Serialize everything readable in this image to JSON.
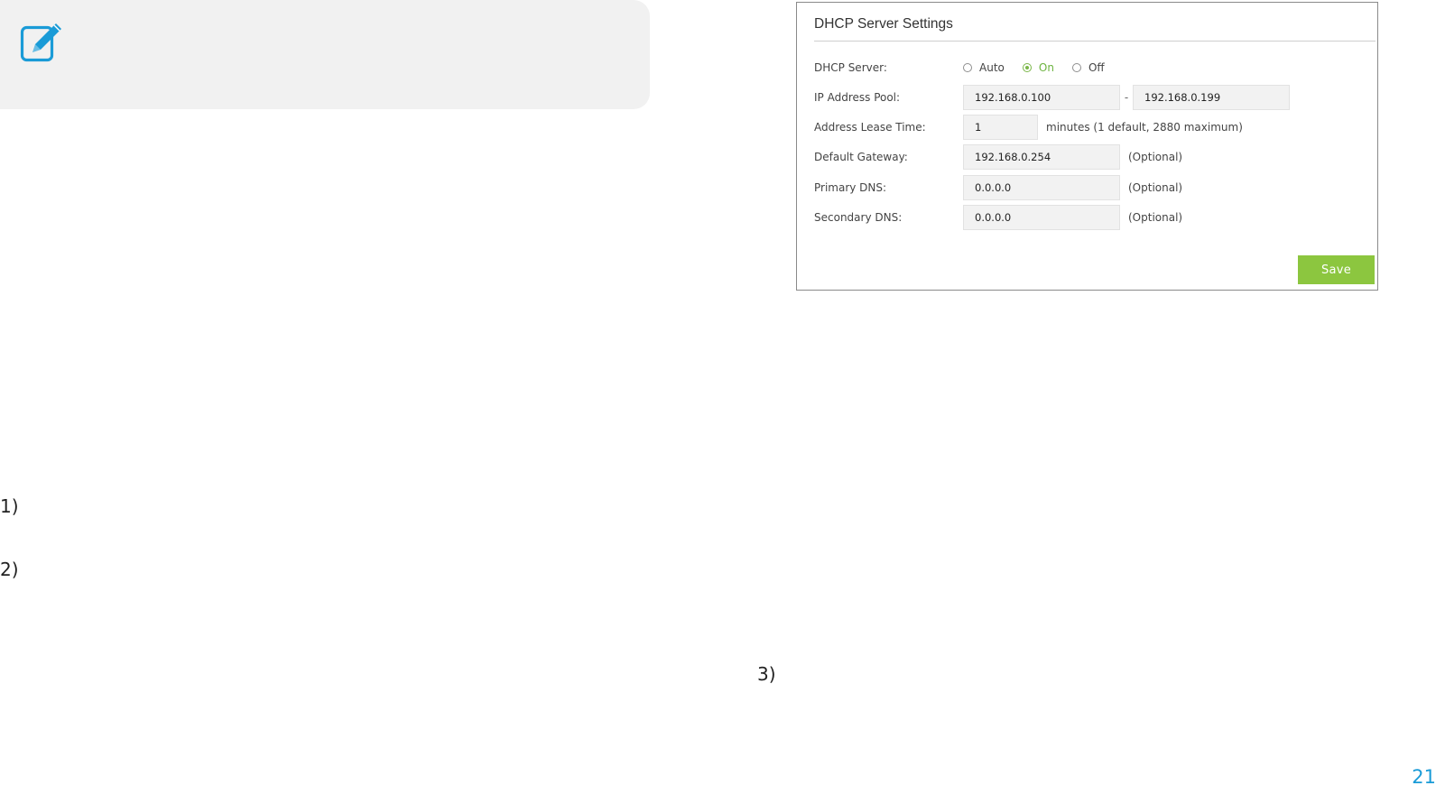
{
  "note": {
    "icon": "edit-note-icon",
    "icon_color": "#1a9bd7"
  },
  "steps": {
    "step1": "1)",
    "step2": "2)",
    "step3": "3)"
  },
  "page_number": "21",
  "dhcp": {
    "title": "DHCP Server Settings",
    "server": {
      "label": "DHCP Server:",
      "options": [
        "Auto",
        "On",
        "Off"
      ],
      "selected": "On"
    },
    "ip_pool": {
      "label": "IP Address Pool:",
      "start": "192.168.0.100",
      "separator": "-",
      "end": "192.168.0.199"
    },
    "lease_time": {
      "label": "Address Lease Time:",
      "value": "1",
      "hint": "minutes (1 default, 2880 maximum)"
    },
    "gateway": {
      "label": "Default Gateway:",
      "value": "192.168.0.254",
      "hint": "(Optional)"
    },
    "primary_dns": {
      "label": "Primary DNS:",
      "value": "0.0.0.0",
      "hint": "(Optional)"
    },
    "secondary_dns": {
      "label": "Secondary DNS:",
      "value": "0.0.0.0",
      "hint": "(Optional)"
    },
    "save_label": "Save",
    "accent_color": "#8cc63f"
  }
}
